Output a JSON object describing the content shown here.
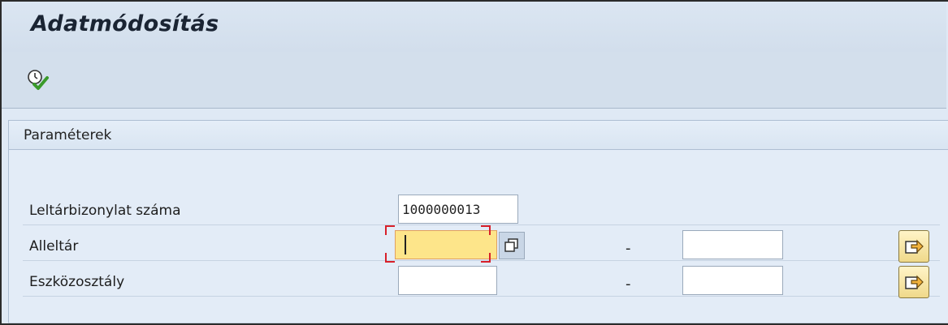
{
  "window": {
    "title": "Adatmódosítás"
  },
  "toolbar": {
    "execute_icon": "execute-clock-check-icon"
  },
  "panel": {
    "title": "Paraméterek",
    "rows": [
      {
        "label": "Leltárbizonylat száma",
        "value": "1000000013"
      },
      {
        "label": "Alleltár",
        "value_from": "",
        "value_to": "",
        "range_separator": "-",
        "f4_icon": "value-help-icon",
        "multi_icon": "multiple-selection-arrow-icon"
      },
      {
        "label": "Eszközosztály",
        "value_from": "",
        "value_to": "",
        "range_separator": "-",
        "multi_icon": "multiple-selection-arrow-icon"
      }
    ]
  },
  "colors": {
    "background": "#dfe9f5",
    "focus_field": "#fde58a",
    "focus_corner": "#d8202a",
    "multi_button": "#f0d98a"
  }
}
